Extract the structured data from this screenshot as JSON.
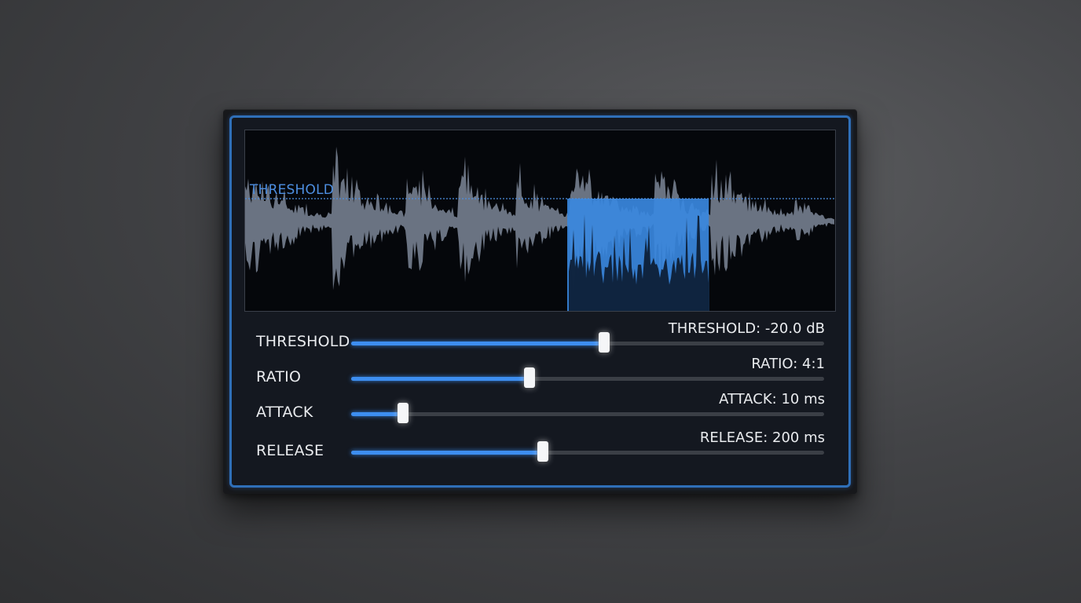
{
  "display": {
    "threshold_label": "THRESHOLD",
    "threshold_level": 0.38,
    "compressed_region": [
      0.546,
      0.786
    ],
    "colors": {
      "waveform": "#6a7382",
      "compressed": "#3a88e0",
      "threshold_line": "#4d8ee0"
    }
  },
  "controls": [
    {
      "id": "threshold",
      "label": "THRESHOLD",
      "readout": "THRESHOLD: -20.0 dB",
      "value": 0.535
    },
    {
      "id": "ratio",
      "label": "RATIO",
      "readout": "RATIO: 4:1",
      "value": 0.377
    },
    {
      "id": "attack",
      "label": "ATTACK",
      "readout": "ATTACK: 10 ms",
      "value": 0.11
    },
    {
      "id": "release",
      "label": "RELEASE",
      "readout": "RELEASE: 200 ms",
      "value": 0.405
    }
  ],
  "accent_color": "#3d8ef0"
}
